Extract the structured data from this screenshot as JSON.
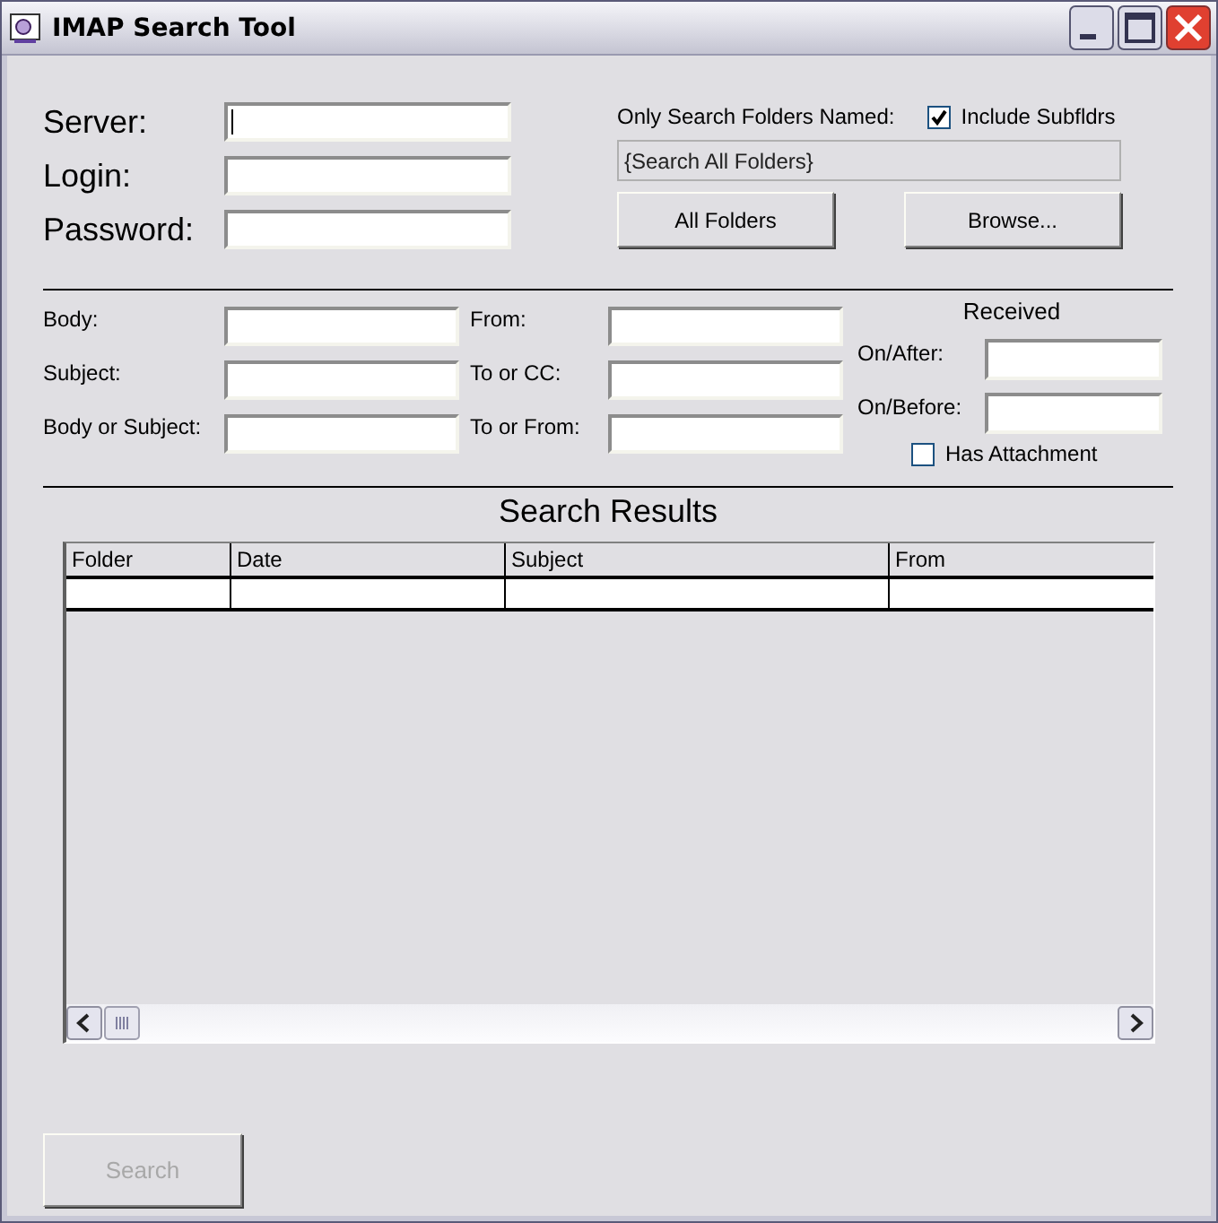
{
  "window": {
    "title": "IMAP Search Tool"
  },
  "login": [
    {
      "label": "Server:",
      "focused": true
    },
    {
      "label": "Login:",
      "focused": false
    },
    {
      "label": "Password:",
      "focused": false
    }
  ],
  "folders": {
    "label": "Only Search Folders Named:",
    "include_subfolders": {
      "label": "Include Subfldrs",
      "checked": true
    },
    "value": "{Search All Folders}",
    "buttons": [
      "All Folders",
      "Browse..."
    ]
  },
  "criteria": [
    {
      "label": "Body:"
    },
    {
      "label": "From:"
    },
    {
      "label": "Subject:"
    },
    {
      "label": "To or CC:"
    },
    {
      "label": "Body or Subject:"
    },
    {
      "label": "To or From:"
    }
  ],
  "received": {
    "heading": "Received",
    "fields": [
      {
        "label": "On/After:"
      },
      {
        "label": "On/Before:"
      }
    ],
    "has_attachment": {
      "label": "Has Attachment",
      "checked": false
    }
  },
  "results": {
    "title": "Search Results",
    "columns": [
      "Folder",
      "Date",
      "Subject",
      "From"
    ]
  },
  "search_button": {
    "label": "Search",
    "disabled": true
  }
}
